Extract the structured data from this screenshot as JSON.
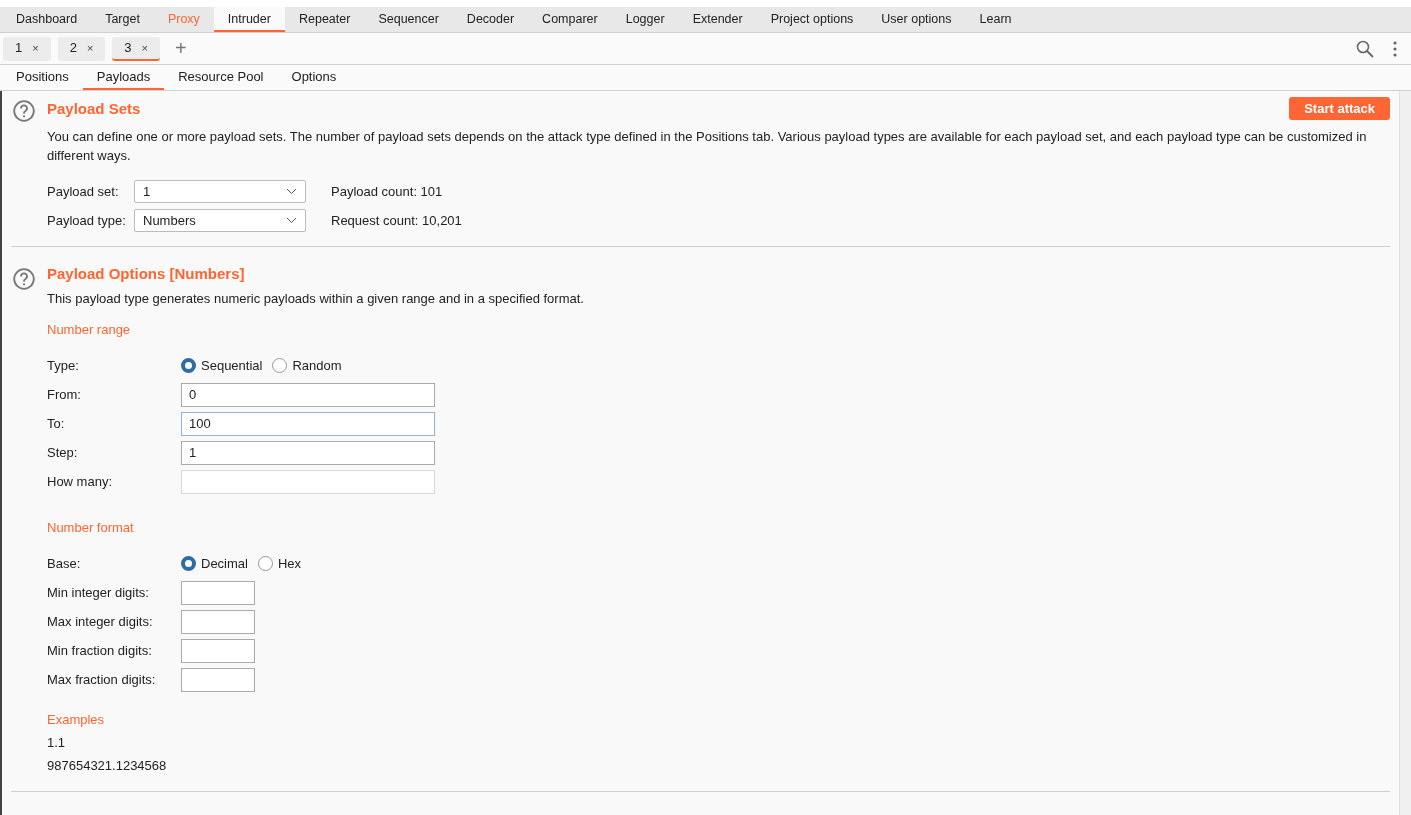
{
  "main_tabs": [
    {
      "label": "Dashboard",
      "selected": false,
      "alert": false
    },
    {
      "label": "Target",
      "selected": false,
      "alert": false
    },
    {
      "label": "Proxy",
      "selected": false,
      "alert": true
    },
    {
      "label": "Intruder",
      "selected": true,
      "alert": false
    },
    {
      "label": "Repeater",
      "selected": false,
      "alert": false
    },
    {
      "label": "Sequencer",
      "selected": false,
      "alert": false
    },
    {
      "label": "Decoder",
      "selected": false,
      "alert": false
    },
    {
      "label": "Comparer",
      "selected": false,
      "alert": false
    },
    {
      "label": "Logger",
      "selected": false,
      "alert": false
    },
    {
      "label": "Extender",
      "selected": false,
      "alert": false
    },
    {
      "label": "Project options",
      "selected": false,
      "alert": false
    },
    {
      "label": "User options",
      "selected": false,
      "alert": false
    },
    {
      "label": "Learn",
      "selected": false,
      "alert": false
    }
  ],
  "attack_tabs": [
    {
      "label": "1",
      "close": "×",
      "selected": false
    },
    {
      "label": "2",
      "close": "×",
      "selected": false
    },
    {
      "label": "3",
      "close": "×",
      "selected": true
    }
  ],
  "add_tab": "+",
  "sub_tabs": [
    {
      "label": "Positions",
      "selected": false
    },
    {
      "label": "Payloads",
      "selected": true
    },
    {
      "label": "Resource Pool",
      "selected": false
    },
    {
      "label": "Options",
      "selected": false
    }
  ],
  "payload_sets": {
    "title": "Payload Sets",
    "button": "Start attack",
    "description": "You can define one or more payload sets. The number of payload sets depends on the attack type defined in the Positions tab. Various payload types are available for each payload set, and each payload type can be customized in different ways.",
    "rows": [
      {
        "label": "Payload set:",
        "value": "1",
        "info": "Payload count: 101"
      },
      {
        "label": "Payload type:",
        "value": "Numbers",
        "info": "Request count: 10,201"
      }
    ]
  },
  "payload_options": {
    "title": "Payload Options [Numbers]",
    "description": "This payload type generates numeric payloads within a given range and in a specified format.",
    "groups": [
      {
        "heading": "Number range",
        "rows": [
          {
            "kind": "radio",
            "label": "Type:",
            "options": [
              {
                "label": "Sequential",
                "selected": true
              },
              {
                "label": "Random",
                "selected": false
              }
            ]
          },
          {
            "kind": "field",
            "label": "From:",
            "value": "0",
            "focused": false,
            "disabled": false,
            "wide": true
          },
          {
            "kind": "field",
            "label": "To:",
            "value": "100",
            "focused": true,
            "disabled": false,
            "wide": true
          },
          {
            "kind": "field",
            "label": "Step:",
            "value": "1",
            "focused": false,
            "disabled": false,
            "wide": true
          },
          {
            "kind": "field",
            "label": "How many:",
            "focused": false,
            "disabled": true,
            "wide": true
          }
        ]
      },
      {
        "heading": "Number format",
        "rows": [
          {
            "kind": "radio",
            "label": "Base:",
            "options": [
              {
                "label": "Decimal",
                "selected": true
              },
              {
                "label": "Hex",
                "selected": false
              }
            ]
          },
          {
            "kind": "field",
            "label": "Min integer digits:",
            "focused": false,
            "disabled": false,
            "wide": false
          },
          {
            "kind": "field",
            "label": "Max integer digits:",
            "focused": false,
            "disabled": false,
            "wide": false
          },
          {
            "kind": "field",
            "label": "Min fraction digits:",
            "focused": false,
            "disabled": false,
            "wide": false
          },
          {
            "kind": "field",
            "label": "Max fraction digits:",
            "focused": false,
            "disabled": false,
            "wide": false
          }
        ]
      }
    ],
    "examples": {
      "heading": "Examples",
      "lines": [
        "1.1",
        "987654321.1234568"
      ]
    }
  }
}
